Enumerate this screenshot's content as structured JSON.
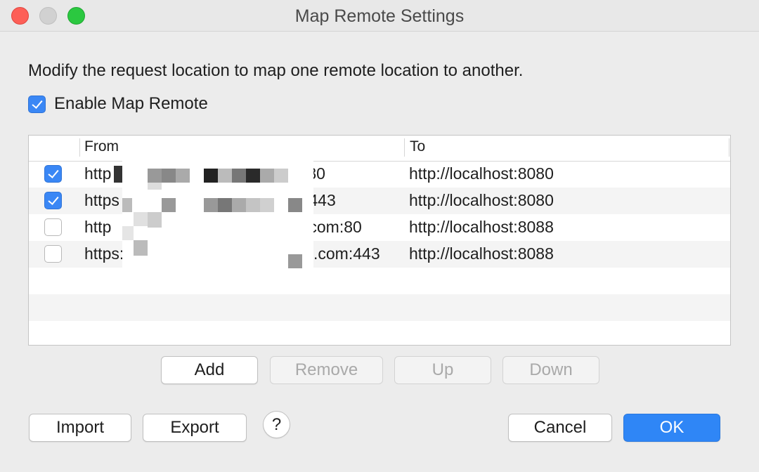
{
  "window": {
    "title": "Map Remote Settings",
    "controls": [
      "close",
      "minimize",
      "maximize"
    ]
  },
  "description": "Modify the request location to map one remote location to another.",
  "enable": {
    "label": "Enable Map Remote",
    "checked": true
  },
  "table": {
    "columns": [
      "From",
      "To"
    ],
    "rows": [
      {
        "enabled": true,
        "from": "http",
        "from_suffix": ":80",
        "to": "http://localhost:8080"
      },
      {
        "enabled": true,
        "from": "https",
        "from_suffix": ":443",
        "to": "http://localhost:8080"
      },
      {
        "enabled": false,
        "from": "http",
        "from_suffix": ".com:80",
        "to": "http://localhost:8088"
      },
      {
        "enabled": false,
        "from": "https:",
        "from_suffix": ".com:443",
        "to": "http://localhost:8088"
      }
    ]
  },
  "row_buttons": {
    "add": "Add",
    "remove": "Remove",
    "up": "Up",
    "down": "Down"
  },
  "footer": {
    "import": "Import",
    "export": "Export",
    "help": "?",
    "cancel": "Cancel",
    "ok": "OK"
  },
  "colors": {
    "accent": "#2f86f6",
    "checkbox": "#3a87f5",
    "close": "#fd5f57",
    "maximize": "#2bc840"
  }
}
